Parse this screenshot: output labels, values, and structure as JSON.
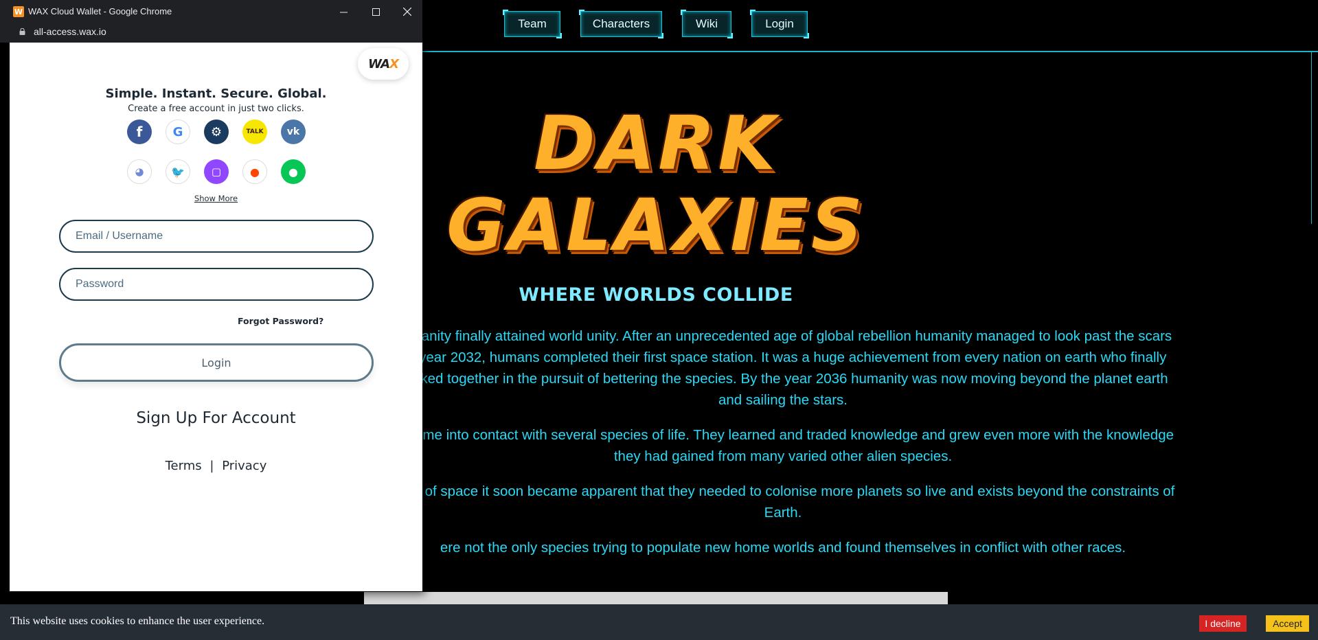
{
  "site": {
    "nav": [
      {
        "label": "Team"
      },
      {
        "label": "Characters"
      },
      {
        "label": "Wiki"
      },
      {
        "label": "Login"
      }
    ],
    "logo": {
      "line1": "DARK",
      "line2": "GALAXIES"
    },
    "tagline": "WHERE WORLDS COLLIDE",
    "paragraphs": [
      "humanity finally attained world unity. After an unprecedented age of global rebellion humanity managed to look past the scars he year 2032, humans completed their first space station. It was a huge achievement from every nation on earth who finally worked together in the pursuit of bettering the species. By the year 2036 humanity was now moving beyond the planet earth and sailing the stars.",
      "to come into contact with several species of life. They learned and traded knowledge and grew even more with the knowledge they had gained from many varied other alien species.",
      "ches of space it soon became apparent that they needed to colonise more planets so live and exists beyond the constraints of Earth.",
      "ere not the only species trying to populate new home worlds and found themselves in conflict with other races."
    ]
  },
  "cookie_bar": {
    "text": "This website uses cookies to enhance the user experience.",
    "decline_label": "I decline",
    "accept_label": "Accept"
  },
  "popup": {
    "window_title": "WAX Cloud Wallet - Google Chrome",
    "url": "all-access.wax.io",
    "brand": {
      "prefix": "WA",
      "x": "X"
    },
    "headline": "Simple. Instant. Secure. Global.",
    "subline": "Create a free account in just two clicks.",
    "social_providers": [
      {
        "name": "Facebook",
        "glyph": "f",
        "icon": "facebook-icon"
      },
      {
        "name": "Google",
        "glyph": "G",
        "icon": "google-icon"
      },
      {
        "name": "Steam",
        "glyph": "⚙",
        "icon": "steam-icon"
      },
      {
        "name": "KakaoTalk",
        "glyph": "TALK",
        "icon": "kakaotalk-icon"
      },
      {
        "name": "VK",
        "glyph": "vk",
        "icon": "vk-icon"
      },
      {
        "name": "Discord",
        "glyph": "◕",
        "icon": "discord-icon"
      },
      {
        "name": "Twitter",
        "glyph": "🐦",
        "icon": "twitter-icon"
      },
      {
        "name": "Twitch",
        "glyph": "▢",
        "icon": "twitch-icon"
      },
      {
        "name": "Reddit",
        "glyph": "●",
        "icon": "reddit-icon"
      },
      {
        "name": "Line",
        "glyph": "●",
        "icon": "line-icon"
      }
    ],
    "show_more": "Show More",
    "email_placeholder": "Email / Username",
    "password_placeholder": "Password",
    "forgot_password": "Forgot Password?",
    "login_label": "Login",
    "signup_label": "Sign Up For Account",
    "terms_label": "Terms",
    "separator": "|",
    "privacy_label": "Privacy"
  },
  "colors": {
    "accent_cyan": "#2cd9f5",
    "logo_orange": "#ffb02b",
    "decline_red": "#d62424",
    "accept_yellow": "#f4c21b",
    "wax_orange": "#f89022"
  }
}
